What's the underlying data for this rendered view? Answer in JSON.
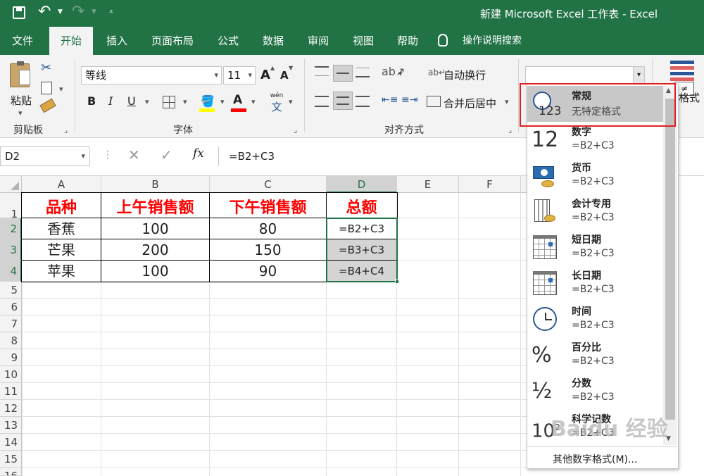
{
  "window": {
    "title": "新建 Microsoft Excel 工作表 - Excel"
  },
  "tabs": [
    "文件",
    "开始",
    "插入",
    "页面布局",
    "公式",
    "数据",
    "审阅",
    "视图",
    "帮助",
    "操作说明搜索"
  ],
  "ribbon": {
    "clipboard": {
      "paste_label": "粘贴",
      "group_label": "剪贴板"
    },
    "font": {
      "font_name": "等线",
      "font_size": "11",
      "bold": "B",
      "italic": "I",
      "underline": "U",
      "grow": "A",
      "shrink": "A",
      "font_color_letter": "A",
      "phonetic": "wén",
      "phonetic_char": "文",
      "group_label": "字体"
    },
    "alignment": {
      "wrap_label": "自动换行",
      "merge_label": "合并后居中",
      "group_label": "对齐方式"
    },
    "number": {
      "format_value": "",
      "partial_label": "格式"
    }
  },
  "formula_bar": {
    "name_box": "D2",
    "fx": "fx",
    "formula": "=B2+C3"
  },
  "columns": [
    "A",
    "B",
    "C",
    "D",
    "E",
    "F"
  ],
  "rows": [
    "1",
    "2",
    "3",
    "4",
    "5",
    "6",
    "7",
    "8",
    "9",
    "10",
    "11",
    "12",
    "13",
    "14",
    "15",
    "16"
  ],
  "sheet": {
    "headers": [
      "品种",
      "上午销售额",
      "下午销售额",
      "总额"
    ],
    "data": [
      [
        "香蕉",
        "100",
        "80",
        "=B2+C3"
      ],
      [
        "芒果",
        "200",
        "150",
        "=B3+C3"
      ],
      [
        "苹果",
        "100",
        "90",
        "=B4+C4"
      ]
    ]
  },
  "dropdown": {
    "items": [
      {
        "name": "常规",
        "value": "无特定格式",
        "icon": "clock-123-icon"
      },
      {
        "name": "数字",
        "value": "=B2+C3",
        "icon": "number-12-icon"
      },
      {
        "name": "货币",
        "value": "=B2+C3",
        "icon": "currency-icon"
      },
      {
        "name": "会计专用",
        "value": "=B2+C3",
        "icon": "accounting-icon"
      },
      {
        "name": "短日期",
        "value": "=B2+C3",
        "icon": "short-date-icon"
      },
      {
        "name": "长日期",
        "value": "=B2+C3",
        "icon": "long-date-icon"
      },
      {
        "name": "时间",
        "value": "=B2+C3",
        "icon": "clock-icon"
      },
      {
        "name": "百分比",
        "value": "=B2+C3",
        "icon": "percent-icon"
      },
      {
        "name": "分数",
        "value": "=B2+C3",
        "icon": "fraction-icon"
      },
      {
        "name": "科学记数",
        "value": "=B2+C3",
        "icon": "scientific-icon"
      }
    ],
    "more_label": "其他数字格式(M)...",
    "highlight_color": "#e02020"
  },
  "watermark": "Baidu 经验",
  "colors": {
    "excel_green": "#217346",
    "header_red": "#ff0000"
  }
}
